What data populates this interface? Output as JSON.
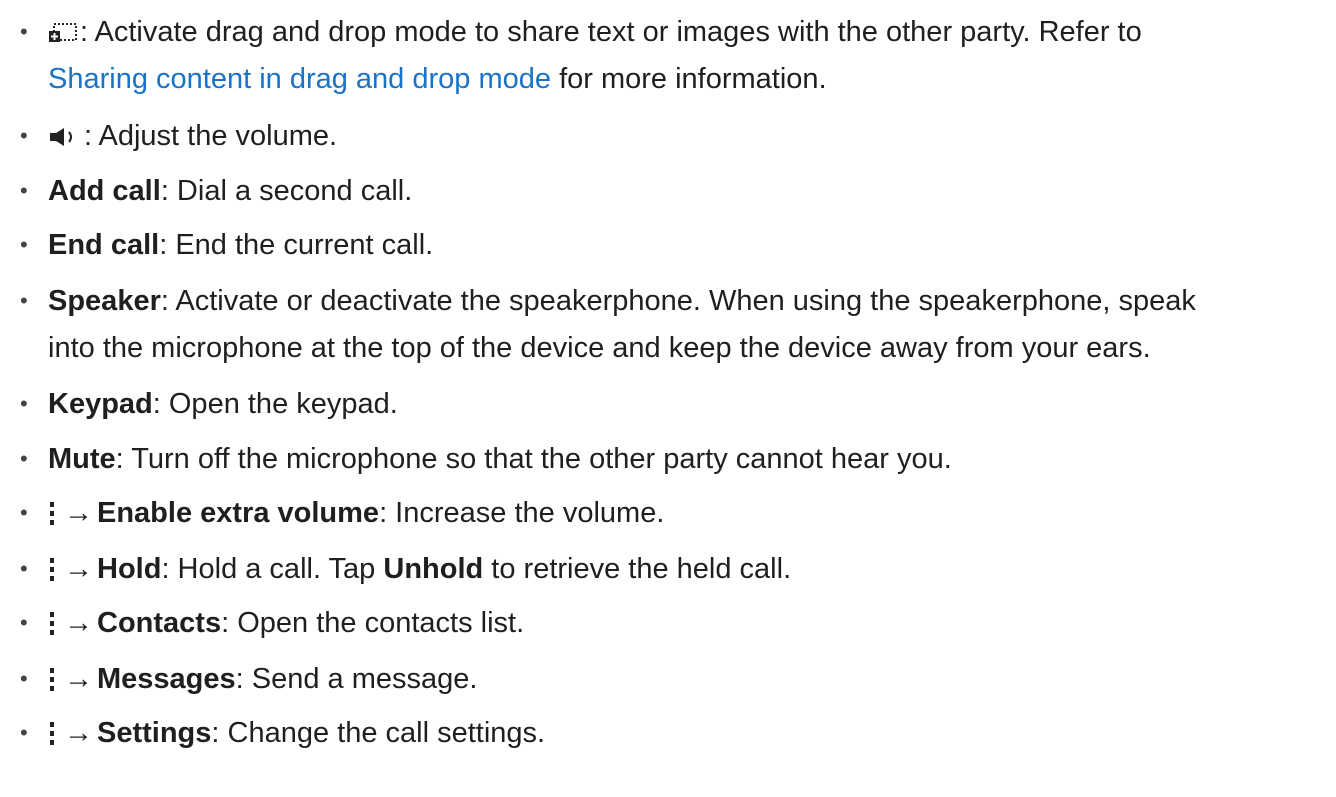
{
  "items": [
    {
      "icon": "drag-drop-icon",
      "rest": ": Activate drag and drop mode to share text or images with the other party. Refer to",
      "link": "Sharing content in drag and drop mode",
      "rest2": "for more information."
    },
    {
      "icon": "volume-icon",
      "rest": ": Adjust the volume."
    },
    {
      "label": "Add call",
      "rest": ": Dial a second call."
    },
    {
      "label": "End call",
      "rest": ": End the current call."
    },
    {
      "label": "Speaker",
      "rest": ": Activate or deactivate the speakerphone. When using the speakerphone, speak",
      "rest2": "into the microphone at the top of the device and keep the device away from your ears."
    },
    {
      "label": "Keypad",
      "rest": ": Open the keypad."
    },
    {
      "label": "Mute",
      "rest": ": Turn off the microphone so that the other party cannot hear you."
    },
    {
      "icon": "more-options-icon",
      "arrow": "→",
      "label": "Enable extra volume",
      "rest": ": Increase the volume."
    },
    {
      "icon": "more-options-icon",
      "arrow": "→",
      "label": "Hold",
      "rest": ": Hold a call. Tap",
      "label2": "Unhold",
      "rest2": "to retrieve the held call."
    },
    {
      "icon": "more-options-icon",
      "arrow": "→",
      "label": "Contacts",
      "rest": ": Open the contacts list."
    },
    {
      "icon": "more-options-icon",
      "arrow": "→",
      "label": "Messages",
      "rest": ": Send a message."
    },
    {
      "icon": "more-options-icon",
      "arrow": "→",
      "label": "Settings",
      "rest": ": Change the call settings."
    }
  ],
  "bullet": "•"
}
